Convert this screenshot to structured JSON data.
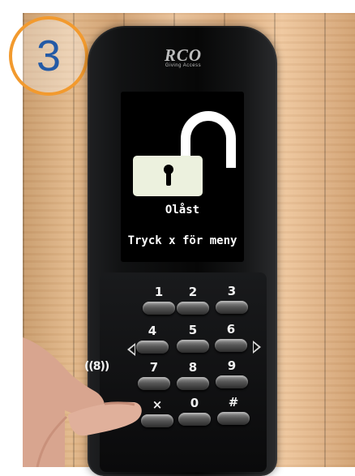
{
  "step_badge": {
    "number": "3",
    "border_color": "#f29a2e",
    "text_color": "#245aa6"
  },
  "device": {
    "brand": "RCO",
    "tagline": "Giving Access",
    "screen": {
      "lock_icon": "unlocked-padlock-icon",
      "status": "Olåst",
      "prompt": "Tryck x för meny"
    },
    "keypad": {
      "keys": [
        "1",
        "2",
        "3",
        "4",
        "5",
        "6",
        "7",
        "8",
        "9",
        "×",
        "0",
        "#"
      ],
      "nfc_indicator": "((8))",
      "nav_icons": [
        "arrow-left-icon",
        "arrow-right-icon"
      ]
    }
  }
}
